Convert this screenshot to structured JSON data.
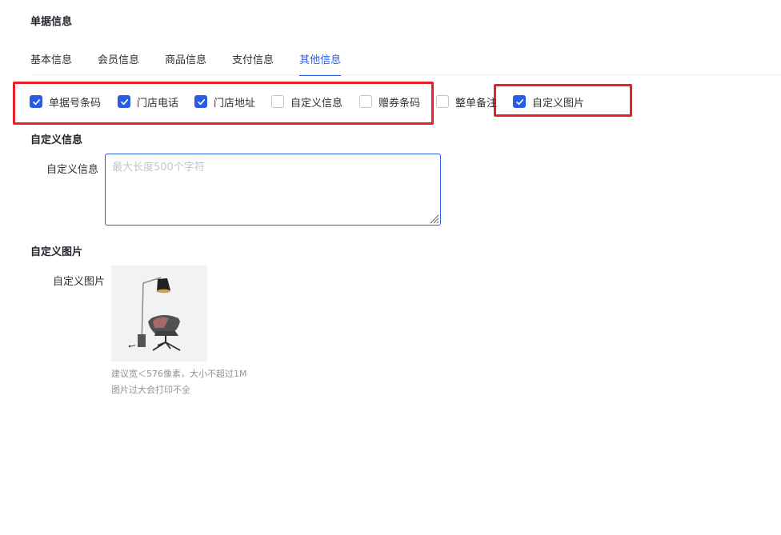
{
  "section": {
    "title": "单据信息"
  },
  "tabs": [
    {
      "label": "基本信息"
    },
    {
      "label": "会员信息"
    },
    {
      "label": "商品信息"
    },
    {
      "label": "支付信息"
    },
    {
      "label": "其他信息"
    }
  ],
  "active_tab": "其他信息",
  "options": [
    {
      "label": "单据号条码",
      "checked": true
    },
    {
      "label": "门店电话",
      "checked": true
    },
    {
      "label": "门店地址",
      "checked": true
    },
    {
      "label": "自定义信息",
      "checked": false
    },
    {
      "label": "赠券条码",
      "checked": false
    },
    {
      "label": "整单备注",
      "checked": false
    },
    {
      "label": "自定义图片",
      "checked": true
    }
  ],
  "custom_info": {
    "title": "自定义信息",
    "label": "自定义信息",
    "placeholder": "最大长度500个字符",
    "value": ""
  },
  "custom_image": {
    "title": "自定义图片",
    "label": "自定义图片",
    "hint_line1": "建议宽＜576像素，大小不超过1M",
    "hint_line2": "图片过大会打印不全"
  },
  "colors": {
    "accent": "#2b5ce6",
    "highlight": "#e8202a"
  }
}
